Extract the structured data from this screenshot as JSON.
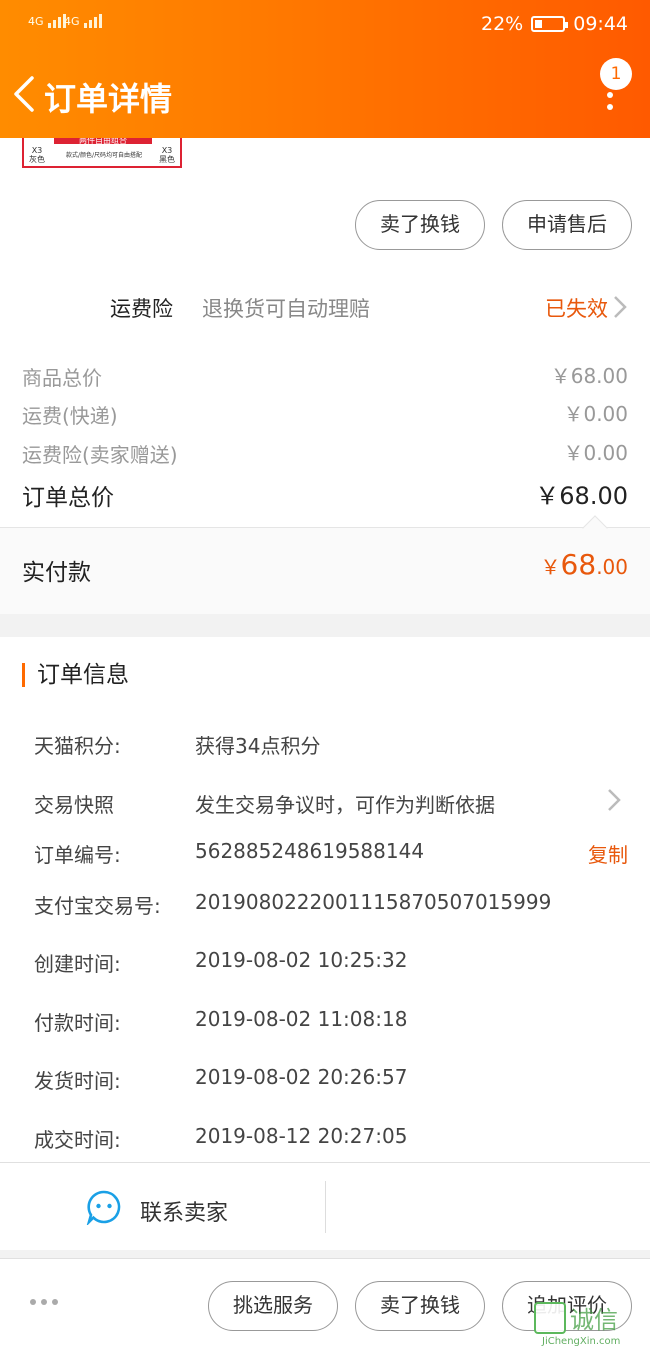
{
  "status_bar": {
    "signal1": "4G",
    "signal2": "4G",
    "battery_pct": "22%",
    "time": "09:44"
  },
  "nav": {
    "title": "订单详情",
    "notification_count": "1",
    "back_icon": "chevron-left-icon",
    "more_icon": "more-vertical-icon"
  },
  "product": {
    "image_band_text": "两件自由组合",
    "left_tag_qty": "X3",
    "left_tag_color": "灰色",
    "right_tag_qty": "X3",
    "right_tag_color": "黑色",
    "middle_text": "款式/颜色/尺码均可自由搭配"
  },
  "actions_top": {
    "sell_label": "卖了换钱",
    "aftersale_label": "申请售后"
  },
  "insurance": {
    "label": "运费险",
    "desc": "退换货可自动理赔",
    "status": "已失效"
  },
  "prices": {
    "goods_label": "商品总价",
    "goods_value": "￥68.00",
    "shipping_label": "运费(快递)",
    "shipping_value": "￥0.00",
    "ins_label": "运费险(卖家赠送)",
    "ins_value": "￥0.00",
    "total_label": "订单总价",
    "total_value": "￥68.00"
  },
  "paid": {
    "label": "实付款",
    "symbol": "￥",
    "integer": "68",
    "decimal": ".00"
  },
  "order_info": {
    "heading": "订单信息",
    "points_label": "天猫积分:",
    "points_value": "获得34点积分",
    "snapshot_label": "交易快照",
    "snapshot_value": "发生交易争议时，可作为判断依据",
    "order_no_label": "订单编号:",
    "order_no_value": "562885248619588144",
    "copy_label": "复制",
    "alipay_label": "支付宝交易号:",
    "alipay_value": "2019080222001115870507015999",
    "created_label": "创建时间:",
    "created_value": "2019-08-02 10:25:32",
    "paid_label": "付款时间:",
    "paid_value": "2019-08-02 11:08:18",
    "shipped_label": "发货时间:",
    "shipped_value": "2019-08-02 20:26:57",
    "closed_label": "成交时间:",
    "closed_value": "2019-08-12 20:27:05"
  },
  "contact": {
    "label": "联系卖家",
    "icon": "chat-bubble-icon"
  },
  "bottom_bar": {
    "pick_service": "挑选服务",
    "sell": "卖了换钱",
    "add_review": "追加评价"
  },
  "watermark": {
    "text": "诚信",
    "sub": "JiChengXin.com"
  },
  "colors": {
    "accent": "#ff6a00",
    "price_orange": "#e8580c"
  }
}
